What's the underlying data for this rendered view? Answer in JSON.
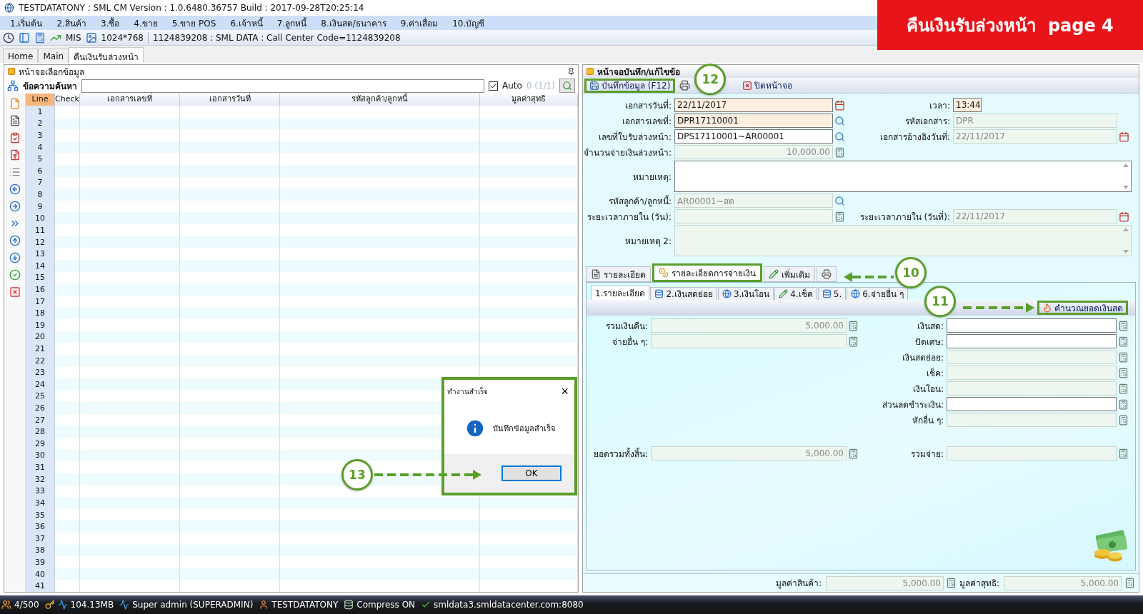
{
  "window": {
    "title": "TESTDATATONY : SML CM Version : 1.0.6480.36757  Build : 2017-09-28T20:25:14"
  },
  "banner": {
    "text": "คืนเงินรับล่วงหน้า  page 4"
  },
  "menu": [
    "1.เริ่มต้น",
    "2.สินค้า",
    "3.ซื้อ",
    "4.ขาย",
    "5.ขาย POS",
    "6.เจ้าหนี้",
    "7.ลูกหนี้",
    "8.เงินสด/ธนาคาร",
    "9.ค่าเสื่อม",
    "10.บัญชี"
  ],
  "toolbar": {
    "mis": "MIS",
    "resolution": "1024*768",
    "info": "1124839208 : SML DATA : Call Center Code=1124839208"
  },
  "tabs": [
    {
      "label": "Home",
      "selected": false
    },
    {
      "label": "Main",
      "selected": false
    },
    {
      "label": "คืนเงินรับล่วงหน้า",
      "selected": true
    }
  ],
  "list_panel": {
    "title": "หน้าจอเลือกข้อมูล",
    "search_label": "ข้อความค้นหา",
    "auto": {
      "label": "Auto",
      "checked": true
    },
    "count": "0 (1/1)",
    "columns": [
      "Line",
      "Check",
      "เอกสารเลขที่",
      "เอกสารวันที่",
      "รหัสลูกค้า/ลูกหนี้",
      "มูลค่าสุทธิ"
    ],
    "rows": [
      "1",
      "2",
      "3",
      "4",
      "5",
      "6",
      "7",
      "8",
      "9",
      "10",
      "11",
      "12",
      "13",
      "14",
      "15",
      "16",
      "17",
      "18",
      "19",
      "20",
      "21",
      "22",
      "23",
      "24",
      "25",
      "26",
      "27",
      "28",
      "29",
      "30",
      "31",
      "32",
      "33",
      "34",
      "35",
      "36",
      "37",
      "38",
      "39",
      "40",
      "41"
    ]
  },
  "edit_panel": {
    "title": "หน้าจอบันทึก/แก้ไขข้อ",
    "save": {
      "label": "บันทึกข้อมูล (F12)",
      "highlighted": true
    },
    "close": "ปิดหน้าจอ",
    "fields": [
      {
        "left": {
          "label": "เอกสารวันที่:",
          "value": "22/11/2017",
          "kind": "date",
          "required": true,
          "readonly": false
        },
        "right": {
          "label": "เวลา:",
          "value": "13:44",
          "kind": "time",
          "required": true,
          "readonly": false
        }
      },
      {
        "left": {
          "label": "เอกสารเลขที่:",
          "value": "DPR17110001",
          "kind": "search",
          "required": true,
          "readonly": false
        },
        "right": {
          "label": "รหัสเอกสาร:",
          "value": "DPR",
          "kind": "text",
          "readonly": true
        }
      },
      {
        "left": {
          "label": "เลขที่ใบรับล่วงหน้า:",
          "value": "DPS17110001~AR00001",
          "kind": "search",
          "required": false,
          "readonly": false
        },
        "right": {
          "label": "เอกสารอ้างอิงวันที่:",
          "value": "22/11/2017",
          "kind": "date",
          "readonly": true
        }
      },
      {
        "left": {
          "label": "จำนวนจ่ายเงินล่วงหน้า:",
          "value": "10,000.00",
          "kind": "calc",
          "readonly": true
        }
      },
      {
        "left": {
          "label": "หมายเหตุ:",
          "kind": "memo",
          "required": false,
          "readonly": false
        }
      },
      {
        "left": {
          "label": "รหัสลูกค้า/ลูกหนี้:",
          "value": "AR00001~สด",
          "kind": "search",
          "readonly": true
        }
      },
      {
        "left": {
          "label": "ระยะเวลาภายใน (วัน):",
          "kind": "calc",
          "readonly": true
        },
        "right": {
          "label": "ระยะเวลาภายใน (วันที่):",
          "value": "22/11/2017",
          "kind": "date",
          "readonly": true
        }
      },
      {
        "left": {
          "label": "หมายเหตุ 2:",
          "kind": "memo",
          "readonly": true
        }
      }
    ],
    "tabs": [
      {
        "label": "รายละเอียด",
        "selected": false,
        "highlighted": false
      },
      {
        "label": "รายละเอียดการจ่ายเงิน",
        "selected": true,
        "highlighted": true
      },
      {
        "label": "เพิ่มเติม",
        "selected": false,
        "highlighted": false
      },
      {
        "selected": false,
        "highlighted": false
      }
    ],
    "sub_tabs": [
      {
        "label": "1.รายละเอียด",
        "selected": true
      },
      {
        "label": "2.เงินสดย่อย",
        "selected": false
      },
      {
        "label": "3.เงินโอน",
        "selected": false
      },
      {
        "label": "4.เช็ค",
        "selected": false
      },
      {
        "label": "5.",
        "selected": false
      },
      {
        "label": "6.จ่ายอื่น ๆ",
        "selected": false
      }
    ],
    "calc_button": {
      "label": "คำนวณยอดเงินสด",
      "highlighted": true
    },
    "payment_left": [
      {
        "label": "รวมเงินคืน:",
        "value": "5,000.00",
        "editable": false
      },
      {
        "label": "จ่ายอื่น ๆ:",
        "editable": false
      }
    ],
    "payment_left_total": {
      "label": "ยอดรวมทั้งสิ้น:",
      "value": "5,000.00",
      "editable": false
    },
    "payment_right": [
      {
        "label": "เงินสด:",
        "editable": true
      },
      {
        "label": "ปัดเศษ:",
        "editable": true
      },
      {
        "label": "เงินสดย่อย:",
        "editable": false
      },
      {
        "label": "เช็ค:",
        "editable": false
      },
      {
        "label": "เงินโอน:",
        "editable": false
      },
      {
        "label": "ส่วนลดชำระเงิน:",
        "editable": true
      },
      {
        "label": "หักอื่น ๆ:",
        "editable": false
      }
    ],
    "payment_right_total": {
      "label": "รวมจ่าย:",
      "editable": false
    },
    "totals": [
      {
        "label": "มูลค่าสินค้า:",
        "value": "5,000.00"
      },
      {
        "label": "มูลค่าสุทธิ:",
        "value": "5,000.00"
      }
    ]
  },
  "dialog": {
    "title": "ทำงานสำเร็จ",
    "close": "×",
    "message": "บันทึกข้อมูลสำเร็จ",
    "button": "OK",
    "highlighted": true
  },
  "callouts": [
    "12",
    "10",
    "11",
    "13"
  ],
  "status_bar": [
    "4/500",
    "104.13MB",
    "Super admin (SUPERADMIN)",
    "TESTDATATONY",
    "Compress ON",
    "smldata3.smldatacenter.com:8080"
  ]
}
